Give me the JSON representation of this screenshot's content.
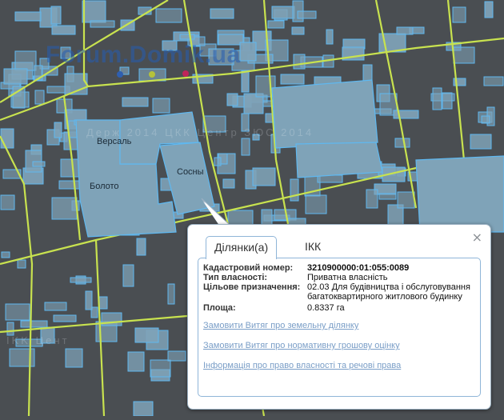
{
  "map": {
    "watermark_logo": "Forum.Domik.ua",
    "watermark_text_1": "Держ  2014  ЦКК  Центр  ЗЮС  2014",
    "watermark_text_2": "IKK  Цент",
    "place_labels": {
      "versal": "Версаль",
      "boloto": "Болото",
      "sosny": "Сосны"
    },
    "colors": {
      "parcel_fill": "#7fa3b8",
      "parcel_stroke": "#5fb8f0",
      "road": "#c8e24f",
      "background": "#4a4e52"
    }
  },
  "popup": {
    "close_icon": "×",
    "tabs": [
      {
        "label": "Ділянки(а)",
        "active": true
      },
      {
        "label": "ІКК",
        "active": false
      }
    ],
    "fields": {
      "cadastral_label": "Кадастровий номер:",
      "cadastral_value": "3210900000:01:055:0089",
      "ownership_label": "Тип власності:",
      "ownership_value": "Приватна власність",
      "purpose_label": "Цільове призначення:",
      "purpose_value": "02.03 Для будівництва і обслуговування багатоквартирного житлового будинку",
      "area_label": "Площа:",
      "area_value": "0.8337 га"
    },
    "links": [
      "Замовити Витяг про земельну ділянку",
      "Замовити Витяг про нормативну грошову оцінку",
      "Інформація про право власності та речові права"
    ]
  }
}
